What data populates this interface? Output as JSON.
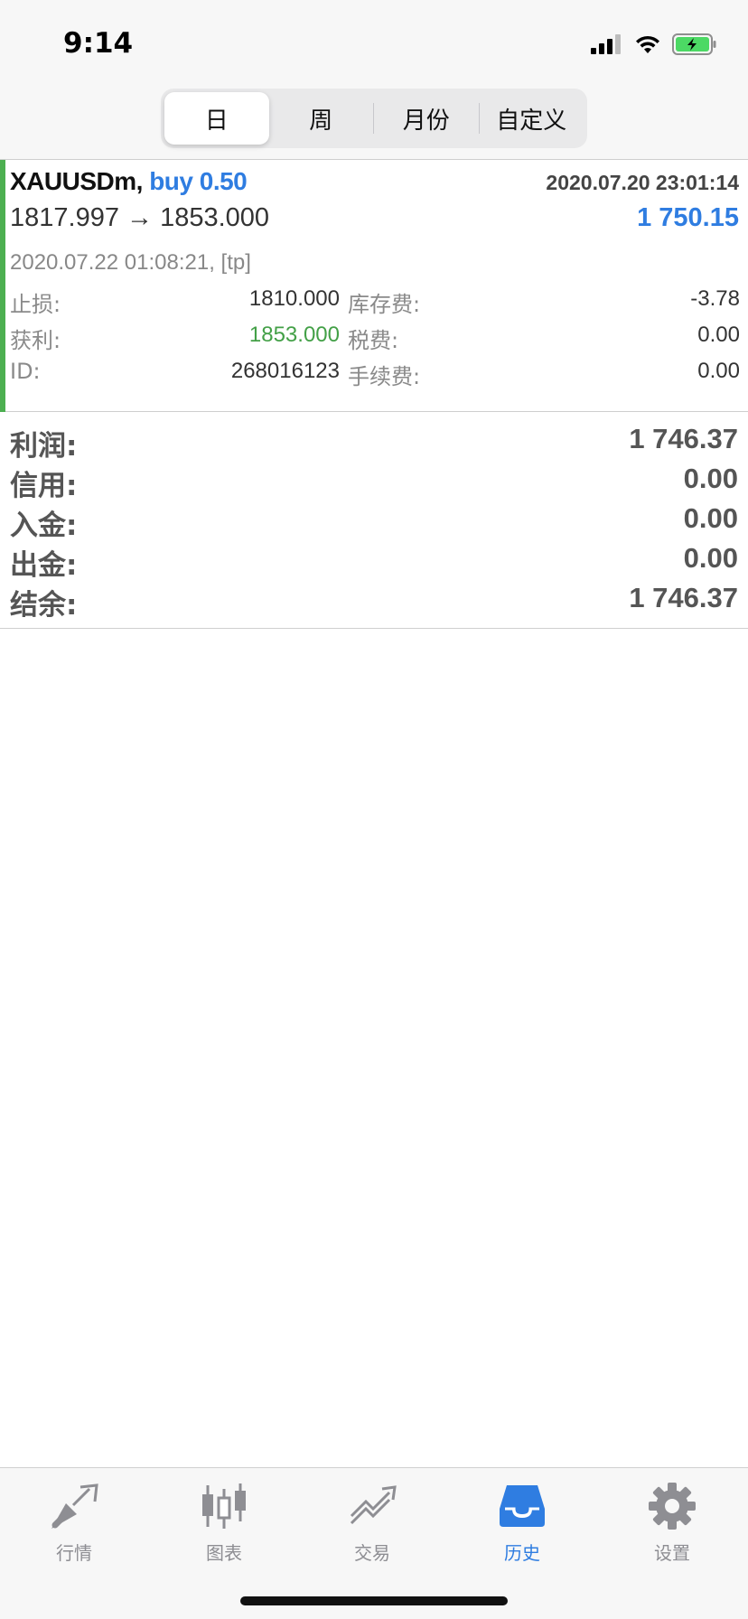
{
  "status_bar": {
    "time": "9:14"
  },
  "period_tabs": {
    "items": [
      {
        "label": "日",
        "active": true
      },
      {
        "label": "周",
        "active": false
      },
      {
        "label": "月份",
        "active": false
      },
      {
        "label": "自定义",
        "active": false
      }
    ]
  },
  "deal": {
    "symbol": "XAUUSDm,",
    "type": "buy 0.50",
    "open_time": "2020.07.20 23:01:14",
    "prices": "1817.997 → 1853.000",
    "profit": "1 750.15",
    "close_time": "2020.07.22 01:08:21, [tp]",
    "details": {
      "stop_loss_label": "止损:",
      "stop_loss_value": "1810.000",
      "swap_label": "库存费:",
      "swap_value": "-3.78",
      "take_profit_label": "获利:",
      "take_profit_value": "1853.000",
      "taxes_label": "税费:",
      "taxes_value": "0.00",
      "id_label": "ID:",
      "id_value": "268016123",
      "commission_label": "手续费:",
      "commission_value": "0.00"
    },
    "accent_color": "#4caf50"
  },
  "summary": {
    "profit_label": "利润:",
    "profit_value": "1 746.37",
    "credit_label": "信用:",
    "credit_value": "0.00",
    "deposit_label": "入金:",
    "deposit_value": "0.00",
    "withdrawal_label": "出金:",
    "withdrawal_value": "0.00",
    "balance_label": "结余:",
    "balance_value": "1 746.37"
  },
  "tab_bar": {
    "items": [
      {
        "label": "行情",
        "icon": "quotes-arrows-icon",
        "active": false
      },
      {
        "label": "图表",
        "icon": "candlestick-chart-icon",
        "active": false
      },
      {
        "label": "交易",
        "icon": "trade-chart-icon",
        "active": false
      },
      {
        "label": "历史",
        "icon": "inbox-history-icon",
        "active": true
      },
      {
        "label": "设置",
        "icon": "gear-icon",
        "active": false
      }
    ]
  },
  "colors": {
    "accent_blue": "#2f7de1",
    "profit_green": "#43a047"
  }
}
